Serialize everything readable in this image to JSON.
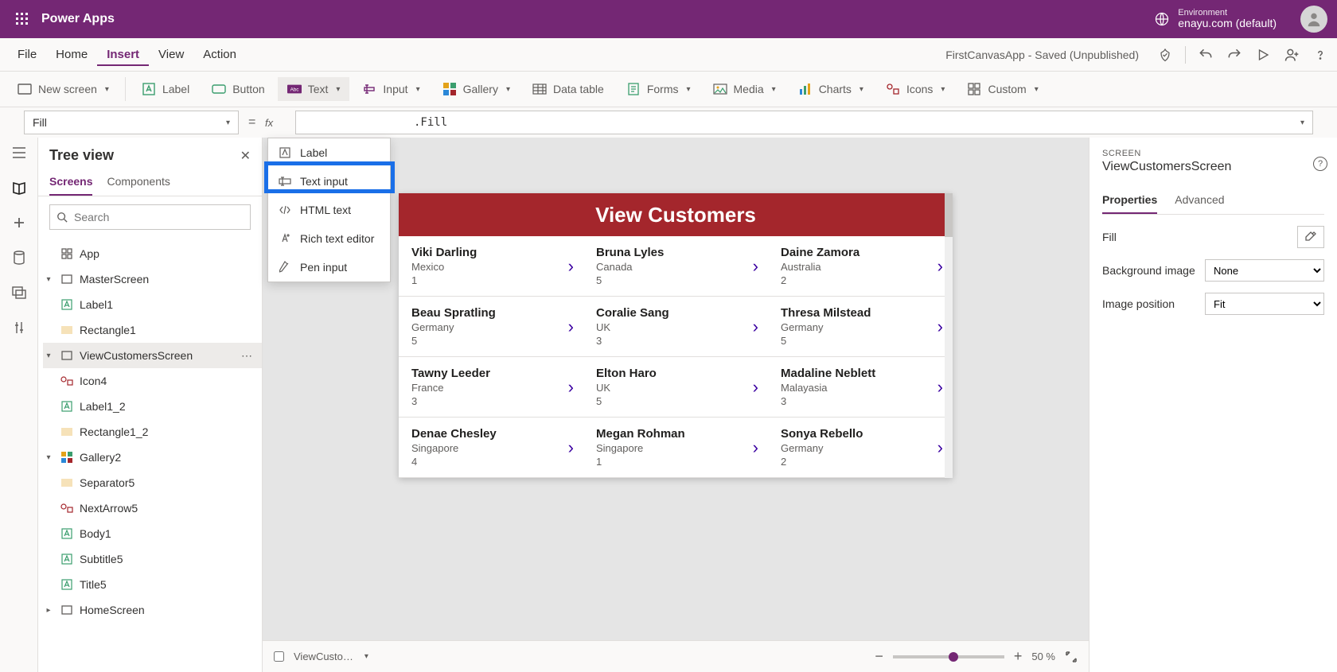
{
  "titlebar": {
    "app": "Power Apps",
    "env_label": "Environment",
    "env_name": "enayu.com (default)"
  },
  "menubar": {
    "items": [
      "File",
      "Home",
      "Insert",
      "View",
      "Action"
    ],
    "active": "Insert",
    "doc_status": "FirstCanvasApp - Saved (Unpublished)"
  },
  "ribbon": {
    "new_screen": "New screen",
    "label": "Label",
    "button": "Button",
    "text": "Text",
    "input": "Input",
    "gallery": "Gallery",
    "data_table": "Data table",
    "forms": "Forms",
    "media": "Media",
    "charts": "Charts",
    "icons": "Icons",
    "custom": "Custom"
  },
  "text_dropdown": {
    "items": [
      "Label",
      "Text input",
      "HTML text",
      "Rich text editor",
      "Pen input"
    ],
    "highlighted": "Text input"
  },
  "formulabar": {
    "property": "Fill",
    "formula_suffix": ".Fill"
  },
  "treeview": {
    "title": "Tree view",
    "tabs": [
      "Screens",
      "Components"
    ],
    "active_tab": "Screens",
    "search_placeholder": "Search",
    "nodes": [
      {
        "label": "App",
        "indent": 1,
        "icon": "app",
        "caret": ""
      },
      {
        "label": "MasterScreen",
        "indent": 1,
        "icon": "screen",
        "caret": "v"
      },
      {
        "label": "Label1",
        "indent": 2,
        "icon": "label",
        "caret": ""
      },
      {
        "label": "Rectangle1",
        "indent": 2,
        "icon": "rect",
        "caret": ""
      },
      {
        "label": "ViewCustomersScreen",
        "indent": 1,
        "icon": "screen",
        "caret": "v",
        "sel": true,
        "dots": true
      },
      {
        "label": "Icon4",
        "indent": 2,
        "icon": "icons",
        "caret": ""
      },
      {
        "label": "Label1_2",
        "indent": 2,
        "icon": "label",
        "caret": ""
      },
      {
        "label": "Rectangle1_2",
        "indent": 2,
        "icon": "rect",
        "caret": ""
      },
      {
        "label": "Gallery2",
        "indent": 2,
        "icon": "gallery",
        "caret": "v"
      },
      {
        "label": "Separator5",
        "indent": 3,
        "icon": "rect",
        "caret": ""
      },
      {
        "label": "NextArrow5",
        "indent": 3,
        "icon": "icons",
        "caret": ""
      },
      {
        "label": "Body1",
        "indent": 3,
        "icon": "label",
        "caret": ""
      },
      {
        "label": "Subtitle5",
        "indent": 3,
        "icon": "label",
        "caret": ""
      },
      {
        "label": "Title5",
        "indent": 3,
        "icon": "label",
        "caret": ""
      },
      {
        "label": "HomeScreen",
        "indent": 1,
        "icon": "screen",
        "caret": ">"
      }
    ]
  },
  "canvas": {
    "title": "View Customers",
    "rows": [
      [
        {
          "name": "Viki  Darling",
          "country": "Mexico",
          "num": "1"
        },
        {
          "name": "Bruna  Lyles",
          "country": "Canada",
          "num": "5"
        },
        {
          "name": "Daine  Zamora",
          "country": "Australia",
          "num": "2"
        }
      ],
      [
        {
          "name": "Beau  Spratling",
          "country": "Germany",
          "num": "5"
        },
        {
          "name": "Coralie  Sang",
          "country": "UK",
          "num": "3"
        },
        {
          "name": "Thresa  Milstead",
          "country": "Germany",
          "num": "5"
        }
      ],
      [
        {
          "name": "Tawny  Leeder",
          "country": "France",
          "num": "3"
        },
        {
          "name": "Elton  Haro",
          "country": "UK",
          "num": "5"
        },
        {
          "name": "Madaline  Neblett",
          "country": "Malayasia",
          "num": "3"
        }
      ],
      [
        {
          "name": "Denae  Chesley",
          "country": "Singapore",
          "num": "4"
        },
        {
          "name": "Megan  Rohman",
          "country": "Singapore",
          "num": "1"
        },
        {
          "name": "Sonya  Rebello",
          "country": "Germany",
          "num": "2"
        }
      ]
    ]
  },
  "canvas_footer": {
    "crumb": "ViewCusto…",
    "zoom_pct": "50  %"
  },
  "properties": {
    "category": "SCREEN",
    "name": "ViewCustomersScreen",
    "tabs": [
      "Properties",
      "Advanced"
    ],
    "active_tab": "Properties",
    "rows": {
      "fill_label": "Fill",
      "bg_image_label": "Background image",
      "bg_image_value": "None",
      "img_pos_label": "Image position",
      "img_pos_value": "Fit"
    }
  }
}
